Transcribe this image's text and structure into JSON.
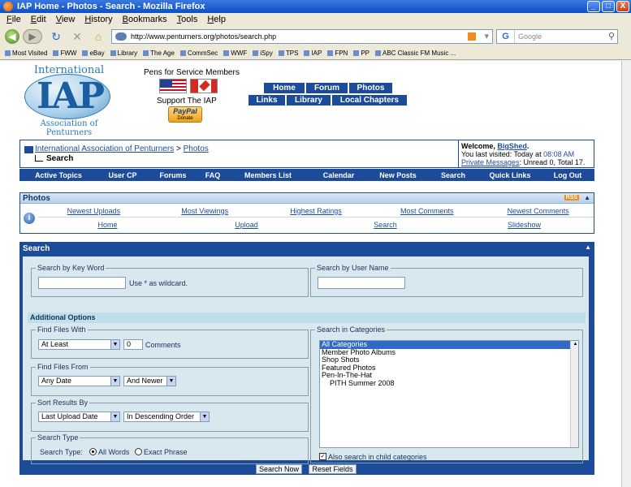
{
  "window": {
    "title": "IAP Home - Photos - Search - Mozilla Firefox",
    "min": "_",
    "max": "□",
    "close": "X"
  },
  "menu": [
    "File",
    "Edit",
    "View",
    "History",
    "Bookmarks",
    "Tools",
    "Help"
  ],
  "browser": {
    "url": "http://www.penturners.org/photos/search.php",
    "search_placeholder": "Google",
    "google_letter": "G"
  },
  "bookmarks": [
    "Most Visited",
    "FWW",
    "eBay",
    "Library",
    "The Age",
    "CommSec",
    "WWF",
    "iSpy",
    "TPS",
    "IAP",
    "FPN",
    "PP",
    "ABC Classic FM Music ..."
  ],
  "logo": {
    "top": "International",
    "main": "IAP",
    "bottom": "Association of Penturners"
  },
  "header": {
    "pens": "Pens for Service Members",
    "support": "Support The IAP",
    "paypal": "PayPal",
    "donate": "Donate"
  },
  "topnav": {
    "row1": [
      "Home",
      "Forum",
      "Photos"
    ],
    "row2": [
      "Links",
      "Library",
      "Local Chapters"
    ]
  },
  "breadcrumb": {
    "root": "International Association of Penturners",
    "sep": ">",
    "section": "Photos",
    "current": "Search"
  },
  "welcome": {
    "greeting": "Welcome,",
    "user": "BigShed",
    "period": ".",
    "visited": "You last visited: Today at",
    "time": "08:08 AM",
    "pm": "Private Messages",
    "pm_counts": ": Unread 0, Total 17."
  },
  "mainnav": [
    "Active Topics",
    "User CP",
    "Forums",
    "FAQ",
    "Members List",
    "Calendar",
    "New Posts",
    "Search",
    "Quick Links",
    "Log Out"
  ],
  "photos": {
    "title": "Photos",
    "rss": "RSS",
    "row1": [
      "Newest Uploads",
      "Most Viewings",
      "Highest Ratings",
      "Most Comments",
      "Newest Comments"
    ],
    "row2": [
      "Home",
      "Upload",
      "Search",
      "Slideshow"
    ]
  },
  "search": {
    "title": "Search",
    "keyword_legend": "Search by Key Word",
    "keyword_value": "",
    "wildcard": "Use * as wildcard.",
    "username_legend": "Search by User Name",
    "username_value": "",
    "additional": "Additional Options",
    "find_with_legend": "Find Files With",
    "find_with_select": "At Least",
    "find_with_count": "0",
    "comments": "Comments",
    "find_from_legend": "Find Files From",
    "date_select": "Any Date",
    "date_dir": "And Newer",
    "sort_legend": "Sort Results By",
    "sort_select": "Last Upload Date",
    "sort_order": "In Descending Order",
    "type_legend": "Search Type",
    "type_label": "Search Type:",
    "all_words": "All Words",
    "exact_phrase": "Exact Phrase",
    "categories_legend": "Search in Categories",
    "categories": [
      "All Categories",
      "Member Photo Albums",
      "Shop Shots",
      "Featured Photos",
      "Pen-In-The-Hat",
      "PITH Summer 2008"
    ],
    "child_cats": "Also search in child categories",
    "search_btn": "Search Now",
    "reset_btn": "Reset Fields"
  }
}
